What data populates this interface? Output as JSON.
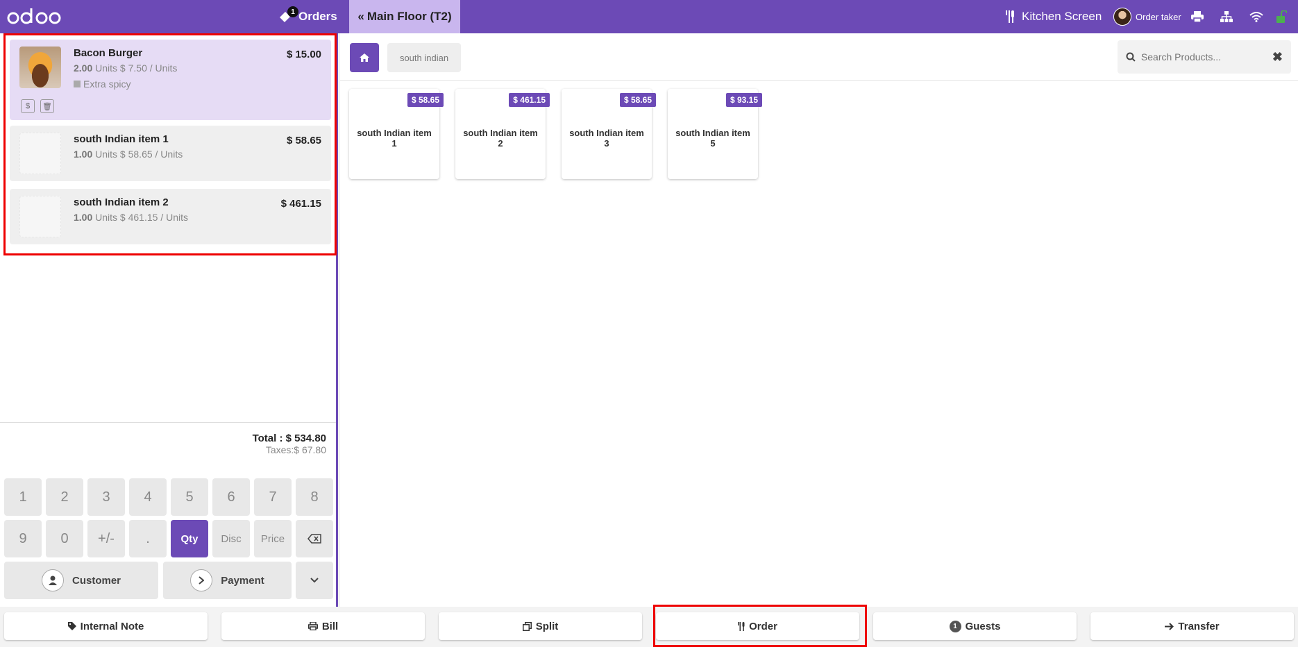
{
  "topbar": {
    "orders_label": "Orders",
    "orders_badge": "1",
    "floor_label": "Main Floor (T2)",
    "kitchen_label": "Kitchen Screen",
    "user_name": "Order taker"
  },
  "orderlines": [
    {
      "name": "Bacon Burger",
      "price": "$ 15.00",
      "qty": "2.00",
      "unit_price": "Units $ 7.50 / Units",
      "note": "Extra spicy"
    },
    {
      "name": "south Indian item 1",
      "price": "$ 58.65",
      "qty": "1.00",
      "unit_price": "Units $ 58.65 / Units"
    },
    {
      "name": "south Indian item 2",
      "price": "$ 461.15",
      "qty": "1.00",
      "unit_price": "Units $ 461.15 / Units"
    }
  ],
  "totals": {
    "total": "Total : $ 534.80",
    "taxes": "Taxes:$ 67.80"
  },
  "numpad": {
    "row1": [
      "1",
      "2",
      "3",
      "4",
      "5",
      "6",
      "7",
      "8"
    ],
    "row2": [
      "9",
      "0",
      "+/-",
      ".",
      "Qty",
      "Disc",
      "Price"
    ],
    "customer_label": "Customer",
    "payment_label": "Payment"
  },
  "products_header": {
    "category_label": "south indian",
    "search_placeholder": "Search Products..."
  },
  "products": [
    {
      "name": "south Indian item 1",
      "price": "$ 58.65"
    },
    {
      "name": "south Indian item 2",
      "price": "$ 461.15"
    },
    {
      "name": "south Indian item 3",
      "price": "$ 58.65"
    },
    {
      "name": "south Indian item 5",
      "price": "$ 93.15"
    }
  ],
  "bottom_bar": {
    "internal_note": "Internal Note",
    "bill": "Bill",
    "split": "Split",
    "order": "Order",
    "guests": "Guests",
    "guests_count": "1",
    "transfer": "Transfer"
  },
  "colors": {
    "brand": "#6c4ab6",
    "highlight": "#e00000",
    "selected_line": "#e6dcf5"
  }
}
